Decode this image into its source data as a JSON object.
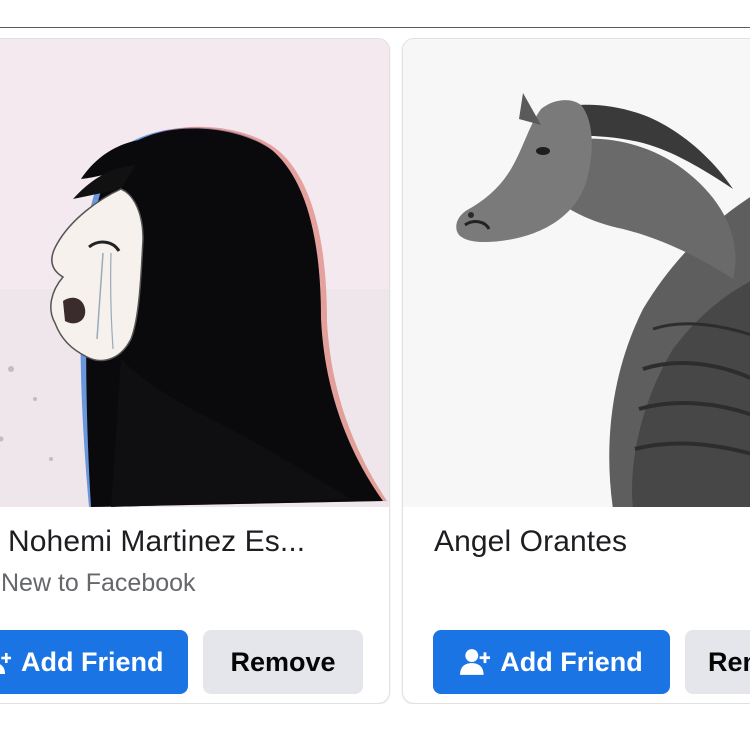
{
  "cards": [
    {
      "name": "Nohemi Martinez Es...",
      "subtitle": "New to Facebook",
      "add_friend_label": "Add Friend",
      "remove_label": "Remove",
      "photo_icon": "anime-girl-crying-illustration"
    },
    {
      "name": "Angel Orantes",
      "add_friend_label": "Add Friend",
      "remove_label": "Remove",
      "photo_icon": "horse-titan-sketch"
    }
  ],
  "colors": {
    "primary_button": "#1b74e4",
    "secondary_button": "#e4e6eb",
    "name_text": "#1c1e21",
    "subtitle_text": "#65676b"
  }
}
